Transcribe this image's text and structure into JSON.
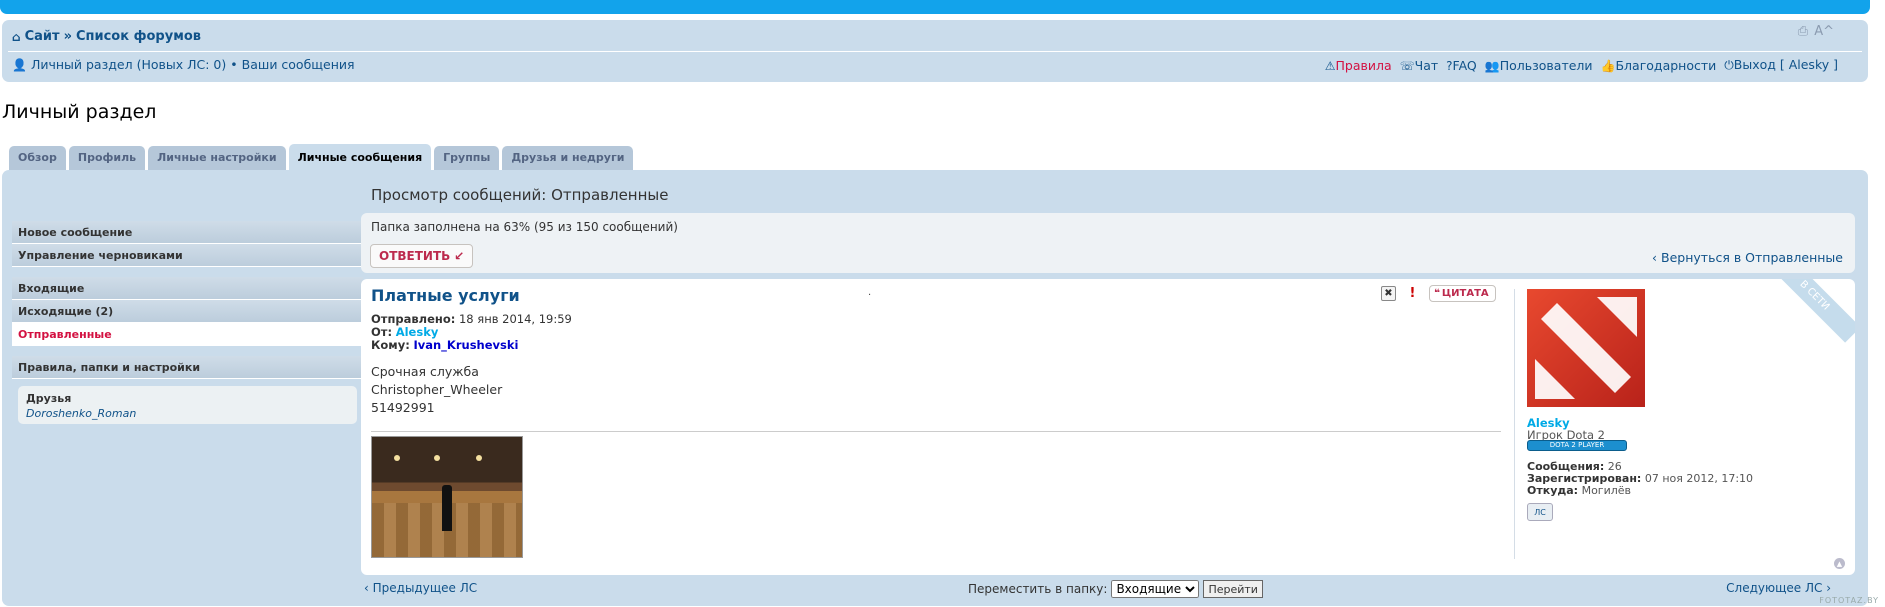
{
  "navbar": {
    "site": "Сайт",
    "separator": "»",
    "forums": "Список форумов",
    "ucp_link": "Личный раздел",
    "new_pm": "(Новых ЛС: 0)",
    "bullet": "•",
    "your_posts": "Ваши сообщения",
    "rules": "Правила",
    "chat": "Чат",
    "faq": "FAQ",
    "users": "Пользователи",
    "thanks": "Благодарности",
    "logout": "Выход [ Alesky ]",
    "font_tools": "A^"
  },
  "page_title": "Личный раздел",
  "tabs": [
    "Обзор",
    "Профиль",
    "Личные настройки",
    "Личные сообщения",
    "Группы",
    "Друзья и недруги"
  ],
  "sidebar": {
    "compose": "Новое сообщение",
    "drafts": "Управление черновиками",
    "inbox": "Входящие",
    "outbox": "Исходящие (2)",
    "sent": "Отправленные",
    "rules_folders": "Правила, папки и настройки",
    "friends_header": "Друзья",
    "friend_name": "Doroshenko_Roman"
  },
  "view": {
    "title": "Просмотр сообщений: Отправленные",
    "quota": "Папка заполнена на 63% (95 из 150 сообщений)",
    "reply": "ОТВЕТИТЬ",
    "back": "Вернуться в Отправленные"
  },
  "message": {
    "subject": "Платные услуги",
    "dot": "·",
    "sent_label": "Отправлено:",
    "sent_value": "18 янв 2014, 19:59",
    "from_label": "От:",
    "from_value": "Alesky",
    "to_label": "Кому:",
    "to_value": "Ivan_Krushevski",
    "body_line1": "Срочная служба",
    "body_line2": "Christopher_Wheeler",
    "body_line3": "51492991",
    "quote_label": "ЦИТАТА"
  },
  "profile": {
    "online": "В СЕТИ",
    "name": "Alesky",
    "rank": "Игрок Dota 2",
    "badge": "DOTA 2 PLAYER",
    "posts_label": "Сообщения:",
    "posts_value": "26",
    "joined_label": "Зарегистрирован:",
    "joined_value": "07 ноя 2012, 17:10",
    "from_label": "Откуда:",
    "from_value": "Могилёв",
    "pm_button": "ЛС"
  },
  "bottom": {
    "prev": "Предыдущее ЛС",
    "move_label": "Переместить в папку:",
    "folder_selected": "Входящие",
    "go": "Перейти",
    "next": "Следующее ЛС",
    "watermark": "FOTOTAZ.BY"
  }
}
